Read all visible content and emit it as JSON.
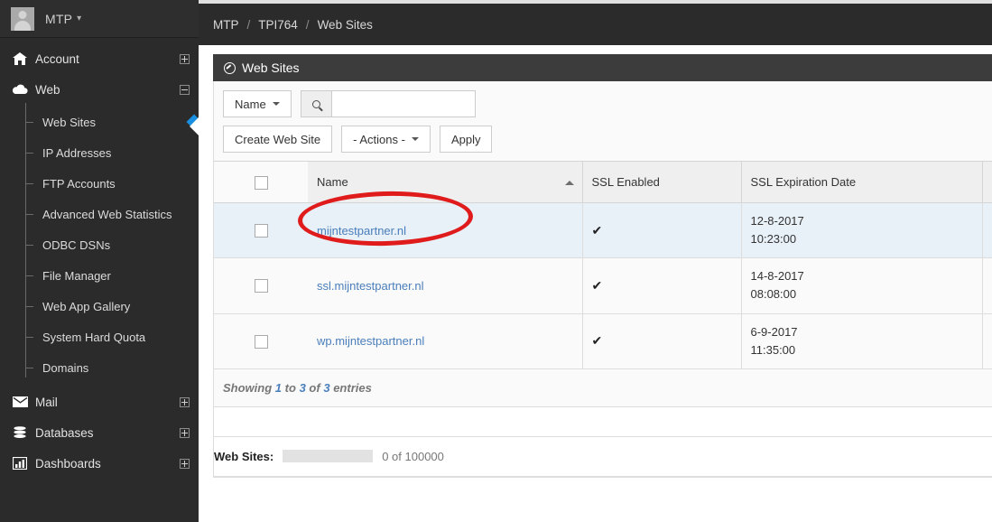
{
  "brand": {
    "name": "MTP",
    "caret": "chevron-down",
    "avatar": "user-avatar-placeholder"
  },
  "sidebar": {
    "groups": [
      {
        "label": "Account",
        "icon": "home-icon",
        "expander": "plus",
        "expanded": false,
        "children": []
      },
      {
        "label": "Web",
        "icon": "cloud-icon",
        "expander": "minus",
        "expanded": true,
        "children": [
          {
            "label": "Web Sites",
            "active": true
          },
          {
            "label": "IP Addresses",
            "active": false
          },
          {
            "label": "FTP Accounts",
            "active": false
          },
          {
            "label": "Advanced Web Statistics",
            "active": false
          },
          {
            "label": "ODBC DSNs",
            "active": false
          },
          {
            "label": "File Manager",
            "active": false
          },
          {
            "label": "Web App Gallery",
            "active": false
          },
          {
            "label": "System Hard Quota",
            "active": false
          },
          {
            "label": "Domains",
            "active": false
          }
        ]
      },
      {
        "label": "Mail",
        "icon": "envelope-icon",
        "expander": "plus",
        "expanded": false,
        "children": []
      },
      {
        "label": "Databases",
        "icon": "database-icon",
        "expander": "plus",
        "expanded": false,
        "children": []
      },
      {
        "label": "Dashboards",
        "icon": "bar-chart-icon",
        "expander": "plus",
        "expanded": false,
        "children": []
      }
    ]
  },
  "breadcrumb": {
    "separator": "/",
    "items": [
      "MTP",
      "TPI764",
      "Web Sites"
    ]
  },
  "panel": {
    "title": "Web Sites",
    "icon": "compass-icon"
  },
  "toolbar": {
    "filter_field_label": "Name",
    "search_icon": "search-icon",
    "search_value": "",
    "search_placeholder": "",
    "create_label": "Create Web Site",
    "actions_label": "- Actions -",
    "apply_label": "Apply"
  },
  "table": {
    "columns": [
      "",
      "Name",
      "SSL Enabled",
      "SSL Expiration Date",
      ""
    ],
    "sorted_column": "Name",
    "sort_direction": "asc",
    "header_checkbox_checked": false,
    "rows": [
      {
        "checked": false,
        "name": "mijntestpartner.nl",
        "ssl_enabled": "✔",
        "exp_date": "12-8-2017",
        "exp_time": "10:23:00",
        "selected": true
      },
      {
        "checked": false,
        "name": "ssl.mijntestpartner.nl",
        "ssl_enabled": "✔",
        "exp_date": "14-8-2017",
        "exp_time": "08:08:00",
        "selected": false
      },
      {
        "checked": false,
        "name": "wp.mijntestpartner.nl",
        "ssl_enabled": "✔",
        "exp_date": "6-9-2017",
        "exp_time": "11:35:00",
        "selected": false
      }
    ]
  },
  "footer": {
    "showing_prefix": "Showing",
    "showing_from": "1",
    "showing_to_word": "to",
    "showing_to": "3",
    "showing_of_word": "of",
    "showing_total": "3",
    "showing_suffix": "entries"
  },
  "quota": {
    "label": "Web Sites:",
    "used": "0",
    "of_word": "of",
    "limit": "100000",
    "text": "0 of 100000",
    "percent": 0
  },
  "annotation": {
    "shape": "ellipse",
    "color": "#e01b1b",
    "target": "mijntestpartner.nl"
  },
  "colors": {
    "sidebar_bg": "#2b2b2b",
    "panel_header_bg": "#3c3c3c",
    "link": "#4a7ebb",
    "selected_row": "#e8f0f8",
    "active_marker": "#1a8fe0",
    "annotation": "#e01b1b"
  }
}
